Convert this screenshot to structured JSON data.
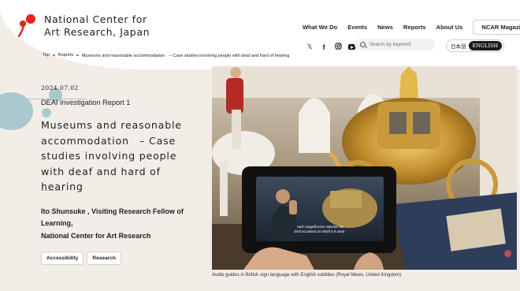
{
  "header": {
    "logo_line1": "National Center for",
    "logo_line2": "Art Research, Japan",
    "brand_color": "#e2261c",
    "nav": [
      "What We Do",
      "Events",
      "News",
      "Reports",
      "About Us"
    ],
    "magazine_button": "NCAR Magazine",
    "social_icons": [
      "x-icon",
      "facebook-icon",
      "instagram-icon",
      "youtube-icon"
    ],
    "search_placeholder": "Search by keyword",
    "lang_jp": "日本語",
    "lang_en": "ENGLISH"
  },
  "breadcrumb": [
    "Top",
    "Reports",
    "Museums and reasonable accommodation　– Case studies involving people with deaf and hard of hearing"
  ],
  "article": {
    "date": "2024.07.02",
    "series": "DEAI Investigation Report 1",
    "title": "Museums and reasonable accommodation　– Case studies involving people with deaf and hard of hearing",
    "author_line1": "Ito Shunsuke , Visiting Research Fellow of Learning,",
    "author_line2": "National Center for Art Research",
    "tags": [
      "Accessibility",
      "Research"
    ]
  },
  "hero": {
    "screen_subtitle_line1": "Such magnificence matches the",
    "screen_subtitle_line2": "chief occasions on which it is used"
  },
  "caption": "Audio guides in British sign language with English subtitles (Royal Mews, United Kingdom)"
}
